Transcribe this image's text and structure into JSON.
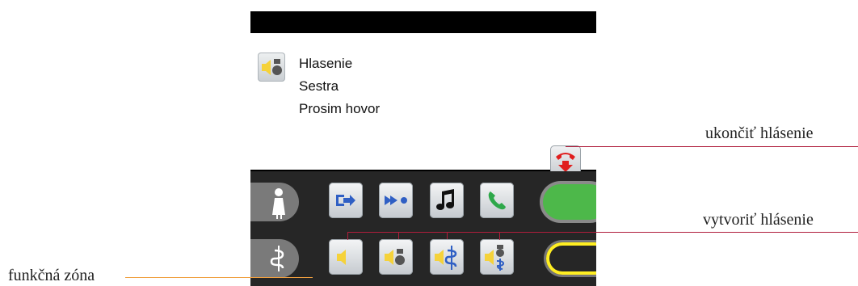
{
  "screen": {
    "message": {
      "icon": "announcement-nurse-icon",
      "lines": [
        "Hlasenie",
        "Sestra",
        "Prosim hovor"
      ]
    },
    "end_button_icon": "end-call-icon",
    "function_zone": {
      "row1": [
        "nurse-presence-icon",
        "exit-arrow-icon",
        "forward-dots-icon",
        "music-icon",
        "phone-icon",
        "green-status-pill"
      ],
      "row2": [
        "doctor-staff-icon",
        "announcement-icon",
        "announcement-nurse-icon",
        "announcement-doctor-icon",
        "announcement-emergency-icon",
        "yellow-status-pill"
      ]
    }
  },
  "annotations": {
    "end_announcement": "ukončiť hlásenie",
    "create_announcement": "vytvoriť hlásenie",
    "function_zone": "funkčná zóna"
  },
  "colors": {
    "annotation_line_red": "#b01e3c",
    "annotation_line_orange": "#f0a040",
    "accent_yellow": "#f5d23a",
    "accent_blue": "#2f5fc4",
    "green_status": "#4db84a"
  }
}
